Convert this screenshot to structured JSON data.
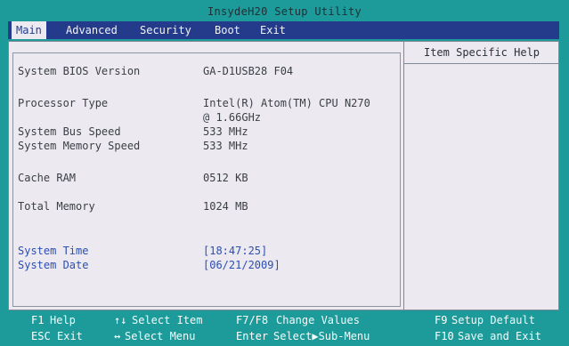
{
  "title": "InsydeH20 Setup Utility",
  "menu": [
    "Main",
    "Advanced",
    "Security",
    "Boot",
    "Exit"
  ],
  "help": {
    "title": "Item Specific Help"
  },
  "info": [
    {
      "label": "System BIOS Version",
      "value": "GA-D1USB28 F04"
    },
    {
      "label": "Processor Type",
      "value": "Intel(R) Atom(TM) CPU N270",
      "value2": "@ 1.66GHz"
    },
    {
      "label": "System Bus Speed",
      "value": "533 MHz"
    },
    {
      "label": "System Memory Speed",
      "value": "533 MHz"
    },
    {
      "label": "Cache RAM",
      "value": "0512 KB"
    },
    {
      "label": "Total Memory",
      "value": "1024 MB"
    },
    {
      "label": "System Time",
      "value": "[18:47:25]"
    },
    {
      "label": "System Date",
      "value": "[06/21/2009]"
    }
  ],
  "footer": {
    "f1": "F1",
    "help": "Help",
    "updown": "↑↓",
    "select_item": "Select Item",
    "f7f8": "F7/F8",
    "change_values": "Change Values",
    "f9": "F9",
    "setup_default": "Setup Default",
    "esc": "ESC",
    "exit": "Exit",
    "leftright": "↔",
    "select_menu": "Select Menu",
    "enter": "Enter",
    "select_submenu": "Select▶Sub-Menu",
    "f10": "F10",
    "save_exit": "Save and Exit"
  },
  "colors": {
    "background": "#1d9b9a",
    "menu_bar": "#233b8a",
    "panel": "#eceaf0",
    "highlight_text": "#2c4eb3"
  }
}
